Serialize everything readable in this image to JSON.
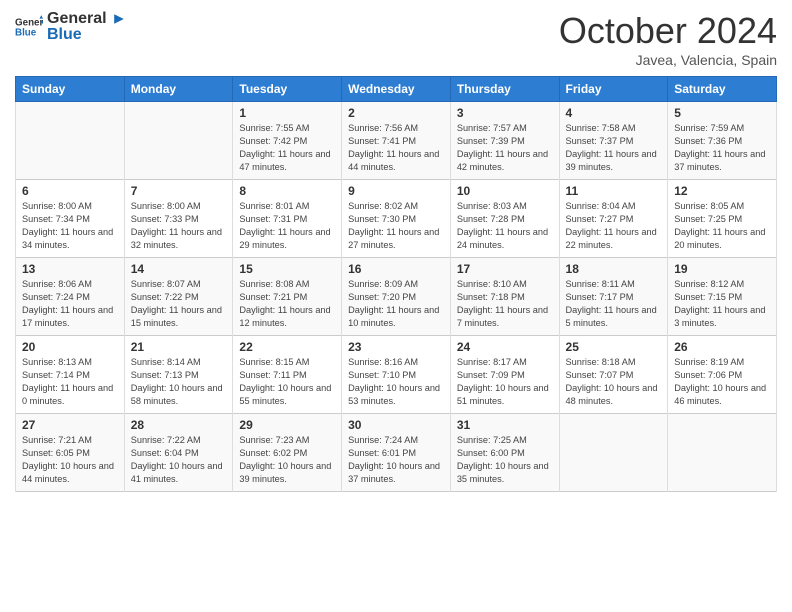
{
  "logo": {
    "line1": "General",
    "line2": "Blue"
  },
  "title": "October 2024",
  "subtitle": "Javea, Valencia, Spain",
  "headers": [
    "Sunday",
    "Monday",
    "Tuesday",
    "Wednesday",
    "Thursday",
    "Friday",
    "Saturday"
  ],
  "weeks": [
    [
      {
        "day": "",
        "info": ""
      },
      {
        "day": "",
        "info": ""
      },
      {
        "day": "1",
        "info": "Sunrise: 7:55 AM\nSunset: 7:42 PM\nDaylight: 11 hours and 47 minutes."
      },
      {
        "day": "2",
        "info": "Sunrise: 7:56 AM\nSunset: 7:41 PM\nDaylight: 11 hours and 44 minutes."
      },
      {
        "day": "3",
        "info": "Sunrise: 7:57 AM\nSunset: 7:39 PM\nDaylight: 11 hours and 42 minutes."
      },
      {
        "day": "4",
        "info": "Sunrise: 7:58 AM\nSunset: 7:37 PM\nDaylight: 11 hours and 39 minutes."
      },
      {
        "day": "5",
        "info": "Sunrise: 7:59 AM\nSunset: 7:36 PM\nDaylight: 11 hours and 37 minutes."
      }
    ],
    [
      {
        "day": "6",
        "info": "Sunrise: 8:00 AM\nSunset: 7:34 PM\nDaylight: 11 hours and 34 minutes."
      },
      {
        "day": "7",
        "info": "Sunrise: 8:00 AM\nSunset: 7:33 PM\nDaylight: 11 hours and 32 minutes."
      },
      {
        "day": "8",
        "info": "Sunrise: 8:01 AM\nSunset: 7:31 PM\nDaylight: 11 hours and 29 minutes."
      },
      {
        "day": "9",
        "info": "Sunrise: 8:02 AM\nSunset: 7:30 PM\nDaylight: 11 hours and 27 minutes."
      },
      {
        "day": "10",
        "info": "Sunrise: 8:03 AM\nSunset: 7:28 PM\nDaylight: 11 hours and 24 minutes."
      },
      {
        "day": "11",
        "info": "Sunrise: 8:04 AM\nSunset: 7:27 PM\nDaylight: 11 hours and 22 minutes."
      },
      {
        "day": "12",
        "info": "Sunrise: 8:05 AM\nSunset: 7:25 PM\nDaylight: 11 hours and 20 minutes."
      }
    ],
    [
      {
        "day": "13",
        "info": "Sunrise: 8:06 AM\nSunset: 7:24 PM\nDaylight: 11 hours and 17 minutes."
      },
      {
        "day": "14",
        "info": "Sunrise: 8:07 AM\nSunset: 7:22 PM\nDaylight: 11 hours and 15 minutes."
      },
      {
        "day": "15",
        "info": "Sunrise: 8:08 AM\nSunset: 7:21 PM\nDaylight: 11 hours and 12 minutes."
      },
      {
        "day": "16",
        "info": "Sunrise: 8:09 AM\nSunset: 7:20 PM\nDaylight: 11 hours and 10 minutes."
      },
      {
        "day": "17",
        "info": "Sunrise: 8:10 AM\nSunset: 7:18 PM\nDaylight: 11 hours and 7 minutes."
      },
      {
        "day": "18",
        "info": "Sunrise: 8:11 AM\nSunset: 7:17 PM\nDaylight: 11 hours and 5 minutes."
      },
      {
        "day": "19",
        "info": "Sunrise: 8:12 AM\nSunset: 7:15 PM\nDaylight: 11 hours and 3 minutes."
      }
    ],
    [
      {
        "day": "20",
        "info": "Sunrise: 8:13 AM\nSunset: 7:14 PM\nDaylight: 11 hours and 0 minutes."
      },
      {
        "day": "21",
        "info": "Sunrise: 8:14 AM\nSunset: 7:13 PM\nDaylight: 10 hours and 58 minutes."
      },
      {
        "day": "22",
        "info": "Sunrise: 8:15 AM\nSunset: 7:11 PM\nDaylight: 10 hours and 55 minutes."
      },
      {
        "day": "23",
        "info": "Sunrise: 8:16 AM\nSunset: 7:10 PM\nDaylight: 10 hours and 53 minutes."
      },
      {
        "day": "24",
        "info": "Sunrise: 8:17 AM\nSunset: 7:09 PM\nDaylight: 10 hours and 51 minutes."
      },
      {
        "day": "25",
        "info": "Sunrise: 8:18 AM\nSunset: 7:07 PM\nDaylight: 10 hours and 48 minutes."
      },
      {
        "day": "26",
        "info": "Sunrise: 8:19 AM\nSunset: 7:06 PM\nDaylight: 10 hours and 46 minutes."
      }
    ],
    [
      {
        "day": "27",
        "info": "Sunrise: 7:21 AM\nSunset: 6:05 PM\nDaylight: 10 hours and 44 minutes."
      },
      {
        "day": "28",
        "info": "Sunrise: 7:22 AM\nSunset: 6:04 PM\nDaylight: 10 hours and 41 minutes."
      },
      {
        "day": "29",
        "info": "Sunrise: 7:23 AM\nSunset: 6:02 PM\nDaylight: 10 hours and 39 minutes."
      },
      {
        "day": "30",
        "info": "Sunrise: 7:24 AM\nSunset: 6:01 PM\nDaylight: 10 hours and 37 minutes."
      },
      {
        "day": "31",
        "info": "Sunrise: 7:25 AM\nSunset: 6:00 PM\nDaylight: 10 hours and 35 minutes."
      },
      {
        "day": "",
        "info": ""
      },
      {
        "day": "",
        "info": ""
      }
    ]
  ]
}
